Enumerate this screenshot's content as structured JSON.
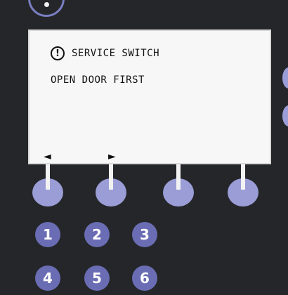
{
  "screen": {
    "warning_icon": "!",
    "title": "SERVICE SWITCH",
    "message": "OPEN DOOR FIRST",
    "nav_left": "◄",
    "nav_right": "►"
  },
  "icons": {
    "warning": "exclamation-circle-icon",
    "prev": "triangle-left-icon",
    "next": "triangle-right-icon"
  },
  "keypad": {
    "keys": [
      "1",
      "2",
      "3",
      "4",
      "5",
      "6"
    ]
  },
  "colors": {
    "panel": "#252629",
    "screen": "#f7f7f7",
    "softkey": "#9a9dd6",
    "numkey": "#6a6db4"
  }
}
